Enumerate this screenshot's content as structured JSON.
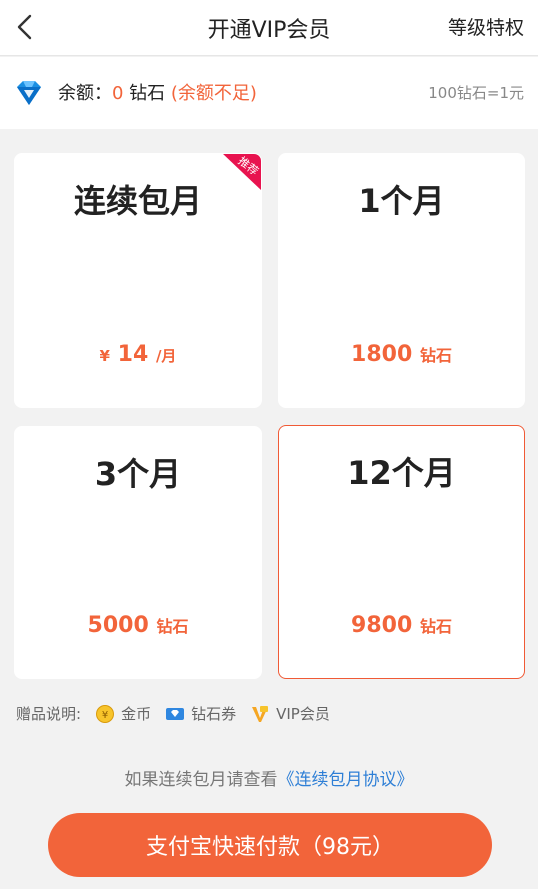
{
  "header": {
    "title": "开通VIP会员",
    "level_link": "等级特权"
  },
  "balance": {
    "label": "余额：",
    "amount": "0",
    "unit": " 钻石 ",
    "warning": "(余额不足)",
    "rate": "100钻石=1元"
  },
  "plans": [
    {
      "title": "连续包月",
      "currency": "¥",
      "price": "14",
      "unit": "/月",
      "badge": "推荐",
      "selected": false
    },
    {
      "title": "1个月",
      "price": "1800",
      "unit": "钻石",
      "selected": false
    },
    {
      "title": "3个月",
      "price": "5000",
      "unit": "钻石",
      "selected": false
    },
    {
      "title": "12个月",
      "price": "9800",
      "unit": "钻石",
      "selected": true
    }
  ],
  "gifts": {
    "label": "赠品说明:",
    "items": [
      {
        "icon": "gold-coin-icon",
        "label": "金币"
      },
      {
        "icon": "diamond-coupon-icon",
        "label": "钻石券"
      },
      {
        "icon": "vip-badge-icon",
        "label": "VIP会员"
      }
    ]
  },
  "agreement": {
    "prefix": "如果连续包月请查看",
    "link": "《连续包月协议》"
  },
  "pay_button": {
    "label": "支付宝快速付款（98元）"
  },
  "colors": {
    "accent": "#f2643a",
    "link": "#2e7fd6",
    "badge": "#e8134f"
  }
}
